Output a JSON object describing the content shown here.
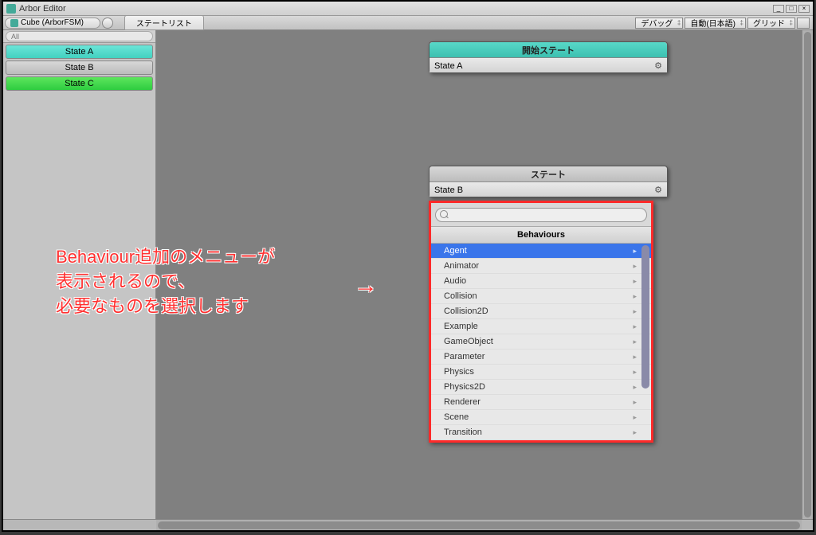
{
  "window": {
    "title": "Arbor Editor"
  },
  "breadcrumb": {
    "label": "Cube (ArborFSM)"
  },
  "tabs": {
    "state_list": "ステートリスト"
  },
  "toolbar": {
    "debug": "デバッグ",
    "lang": "自動(日本語)",
    "grid": "グリッド"
  },
  "sidebar": {
    "search_placeholder": "All",
    "states": [
      {
        "label": "State A",
        "color": "a"
      },
      {
        "label": "State B",
        "color": "b"
      },
      {
        "label": "State C",
        "color": "c"
      }
    ]
  },
  "nodes": {
    "start": {
      "title": "開始ステート",
      "row": "State A"
    },
    "state": {
      "title": "ステート",
      "row": "State B"
    }
  },
  "popup": {
    "search_value": "",
    "title": "Behaviours",
    "items": [
      {
        "label": "Agent",
        "selected": true
      },
      {
        "label": "Animator"
      },
      {
        "label": "Audio"
      },
      {
        "label": "Collision"
      },
      {
        "label": "Collision2D"
      },
      {
        "label": "Example"
      },
      {
        "label": "GameObject"
      },
      {
        "label": "Parameter"
      },
      {
        "label": "Physics"
      },
      {
        "label": "Physics2D"
      },
      {
        "label": "Renderer"
      },
      {
        "label": "Scene"
      },
      {
        "label": "Transition"
      }
    ]
  },
  "annotation": {
    "line1": "Behaviour追加のメニューが",
    "line2": "表示されるので、",
    "line3": "必要なものを選択します",
    "arrow": "→"
  }
}
